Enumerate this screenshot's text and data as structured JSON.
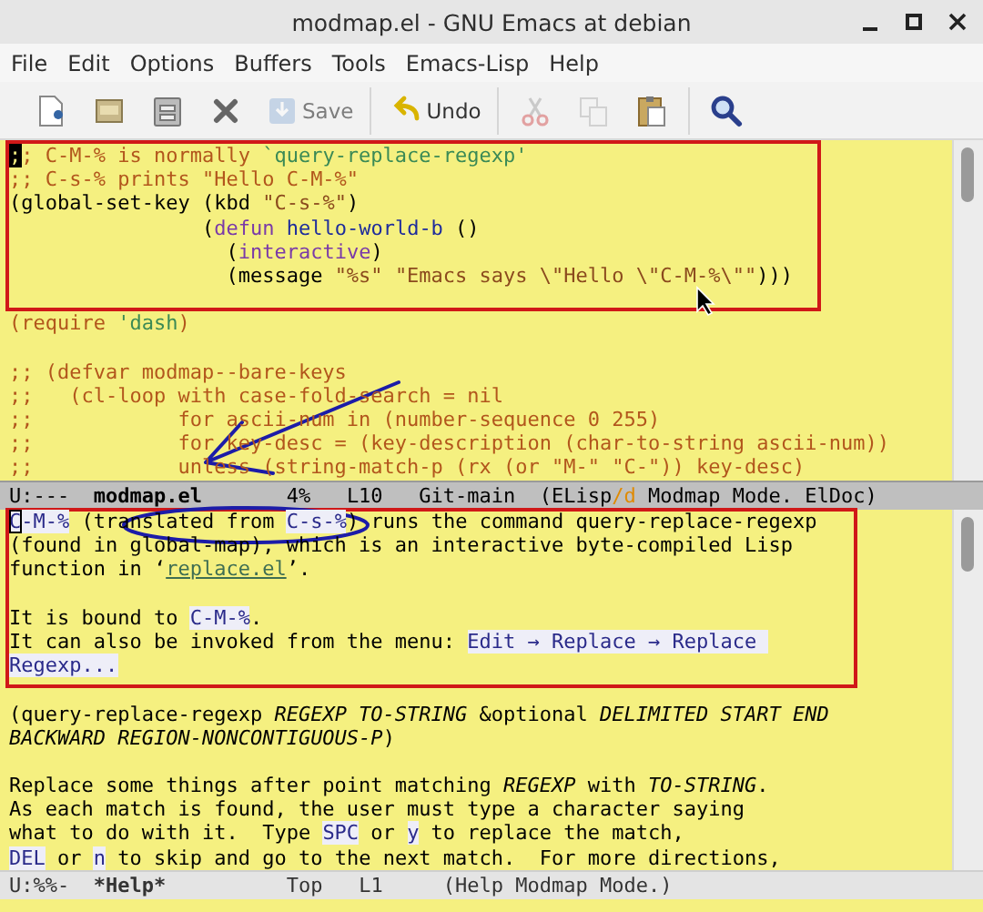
{
  "window": {
    "title": "modmap.el - GNU Emacs at debian"
  },
  "menu": [
    "File",
    "Edit",
    "Options",
    "Buffers",
    "Tools",
    "Emacs-Lisp",
    "Help"
  ],
  "toolbar": [
    {
      "items": [
        {
          "kind": "new-file",
          "disabled": false
        },
        {
          "kind": "open",
          "disabled": false
        },
        {
          "kind": "dired",
          "disabled": false
        },
        {
          "kind": "close",
          "disabled": false
        },
        {
          "kind": "save",
          "label": "Save",
          "disabled": true
        }
      ]
    },
    {
      "items": [
        {
          "kind": "undo",
          "label": "Undo",
          "disabled": false
        }
      ]
    },
    {
      "items": [
        {
          "kind": "cut",
          "disabled": true
        },
        {
          "kind": "copy",
          "disabled": true
        },
        {
          "kind": "paste",
          "disabled": false
        }
      ]
    },
    {
      "items": [
        {
          "kind": "search",
          "disabled": false
        }
      ]
    }
  ],
  "editor": {
    "lines": [
      {
        "kind": "text",
        "segments": [
          {
            "text": ";",
            "kind": "cursor"
          },
          {
            "text": "; C-M-% is normally ",
            "kind": "comment"
          },
          {
            "text": "`query-replace-regexp'",
            "kind": "constant"
          }
        ]
      },
      {
        "kind": "text",
        "segments": [
          {
            "text": ";; C-s-% prints \"Hello C-M-%\"",
            "kind": "comment"
          }
        ]
      },
      {
        "kind": "text",
        "segments": [
          {
            "text": "(global-set-key (kbd ",
            "kind": "default"
          },
          {
            "text": "\"C-s-%\"",
            "kind": "string"
          },
          {
            "text": ")",
            "kind": "default"
          }
        ]
      },
      {
        "kind": "text",
        "segments": [
          {
            "text": "                (",
            "kind": "default"
          },
          {
            "text": "defun",
            "kind": "keyword"
          },
          {
            "text": " hello-world-b",
            "kind": "function"
          },
          {
            "text": " ()",
            "kind": "default"
          }
        ]
      },
      {
        "kind": "text",
        "segments": [
          {
            "text": "                  (",
            "kind": "default"
          },
          {
            "text": "interactive",
            "kind": "keyword"
          },
          {
            "text": ")",
            "kind": "default"
          }
        ]
      },
      {
        "kind": "text",
        "segments": [
          {
            "text": "                  (message ",
            "kind": "default"
          },
          {
            "text": "\"%s\" ",
            "kind": "string"
          },
          {
            "text": "\"Emacs says \\\"Hello \\\"C-M-%\\\"\"",
            "kind": "string"
          },
          {
            "text": ")))",
            "kind": "default"
          }
        ]
      },
      {
        "kind": "blank"
      },
      {
        "kind": "text",
        "segments": [
          {
            "text": "(require ",
            "kind": "comment"
          },
          {
            "text": "'dash",
            "kind": "constant"
          },
          {
            "text": ")",
            "kind": "comment"
          }
        ]
      },
      {
        "kind": "blank"
      },
      {
        "kind": "text",
        "segments": [
          {
            "text": ";; (defvar modmap--bare-keys",
            "kind": "comment"
          }
        ]
      },
      {
        "kind": "text",
        "segments": [
          {
            "text": ";;   (cl-loop with case-fold-search = nil",
            "kind": "comment"
          }
        ]
      },
      {
        "kind": "text",
        "segments": [
          {
            "text": ";;            for ascii-num in (number-sequence 0 255)",
            "kind": "comment"
          }
        ]
      },
      {
        "kind": "text",
        "segments": [
          {
            "text": ";;            for key-desc = (key-description (char-to-string ascii-num))",
            "kind": "comment"
          }
        ]
      },
      {
        "kind": "text",
        "segments": [
          {
            "text": ";;            unless (string-match-p (rx (or \"M-\" \"C-\")) key-desc)",
            "kind": "comment"
          }
        ]
      }
    ]
  },
  "mode_line_top": {
    "active": true,
    "segments": [
      {
        "text": "U:---  ",
        "kind": "default"
      },
      {
        "text": "modmap.el",
        "kind": "bold"
      },
      {
        "text": "       4%   L10   Git-main  (ELisp",
        "kind": "default"
      },
      {
        "text": "/d",
        "kind": "accent"
      },
      {
        "text": " Modmap Mode. ElDoc)",
        "kind": "default"
      }
    ]
  },
  "help": {
    "lines": [
      {
        "kind": "text",
        "segments": [
          {
            "text": "C",
            "kind": "key-cursor"
          },
          {
            "text": "-M-%",
            "kind": "key"
          },
          {
            "text": " (translated from ",
            "kind": "default"
          },
          {
            "text": "C-s-%",
            "kind": "key"
          },
          {
            "text": ") runs the command query-replace-regexp",
            "kind": "default"
          }
        ]
      },
      {
        "kind": "text",
        "segments": [
          {
            "text": "(found in global-map), which is an interactive byte-compiled Lisp",
            "kind": "default"
          }
        ]
      },
      {
        "kind": "text",
        "segments": [
          {
            "text": "function in ‘",
            "kind": "default"
          },
          {
            "text": "replace.el",
            "kind": "link"
          },
          {
            "text": "’.",
            "kind": "default"
          }
        ]
      },
      {
        "kind": "blank"
      },
      {
        "kind": "text",
        "segments": [
          {
            "text": "It is bound to ",
            "kind": "default"
          },
          {
            "text": "C-M-%",
            "kind": "key"
          },
          {
            "text": ".",
            "kind": "default"
          }
        ]
      },
      {
        "kind": "text",
        "segments": [
          {
            "text": "It can also be invoked from the menu: ",
            "kind": "default"
          },
          {
            "text": "Edit → Replace → Replace ",
            "kind": "key"
          }
        ]
      },
      {
        "kind": "text",
        "segments": [
          {
            "text": "Regexp...",
            "kind": "key"
          }
        ]
      },
      {
        "kind": "blank"
      },
      {
        "kind": "text",
        "segments": [
          {
            "text": "(query-replace-regexp ",
            "kind": "default"
          },
          {
            "text": "REGEXP TO-STRING",
            "kind": "arg"
          },
          {
            "text": " &optional ",
            "kind": "default"
          },
          {
            "text": "DELIMITED START END",
            "kind": "arg"
          }
        ]
      },
      {
        "kind": "text",
        "segments": [
          {
            "text": "BACKWARD REGION-NONCONTIGUOUS-P",
            "kind": "arg"
          },
          {
            "text": ")",
            "kind": "default"
          }
        ]
      },
      {
        "kind": "blank"
      },
      {
        "kind": "text",
        "segments": [
          {
            "text": "Replace some things after point matching ",
            "kind": "default"
          },
          {
            "text": "REGEXP",
            "kind": "arg"
          },
          {
            "text": " with ",
            "kind": "default"
          },
          {
            "text": "TO-STRING",
            "kind": "arg"
          },
          {
            "text": ".",
            "kind": "default"
          }
        ]
      },
      {
        "kind": "text",
        "segments": [
          {
            "text": "As each match is found, the user must type a character saying",
            "kind": "default"
          }
        ]
      },
      {
        "kind": "text",
        "segments": [
          {
            "text": "what to do with it.  Type ",
            "kind": "default"
          },
          {
            "text": "SPC",
            "kind": "key"
          },
          {
            "text": " or ",
            "kind": "default"
          },
          {
            "text": "y",
            "kind": "key"
          },
          {
            "text": " to replace the match,",
            "kind": "default"
          }
        ]
      },
      {
        "kind": "text",
        "segments": [
          {
            "text": "DEL",
            "kind": "key"
          },
          {
            "text": " or ",
            "kind": "default"
          },
          {
            "text": "n",
            "kind": "key"
          },
          {
            "text": " to skip and go to the next match.  For more directions,",
            "kind": "default"
          }
        ]
      }
    ]
  },
  "mode_line_bottom": {
    "active": false,
    "segments": [
      {
        "text": "U:%%-  ",
        "kind": "default"
      },
      {
        "text": "*Help*",
        "kind": "bold"
      },
      {
        "text": "          Top   L1     (Help Modmap Mode.)",
        "kind": "default"
      }
    ]
  }
}
